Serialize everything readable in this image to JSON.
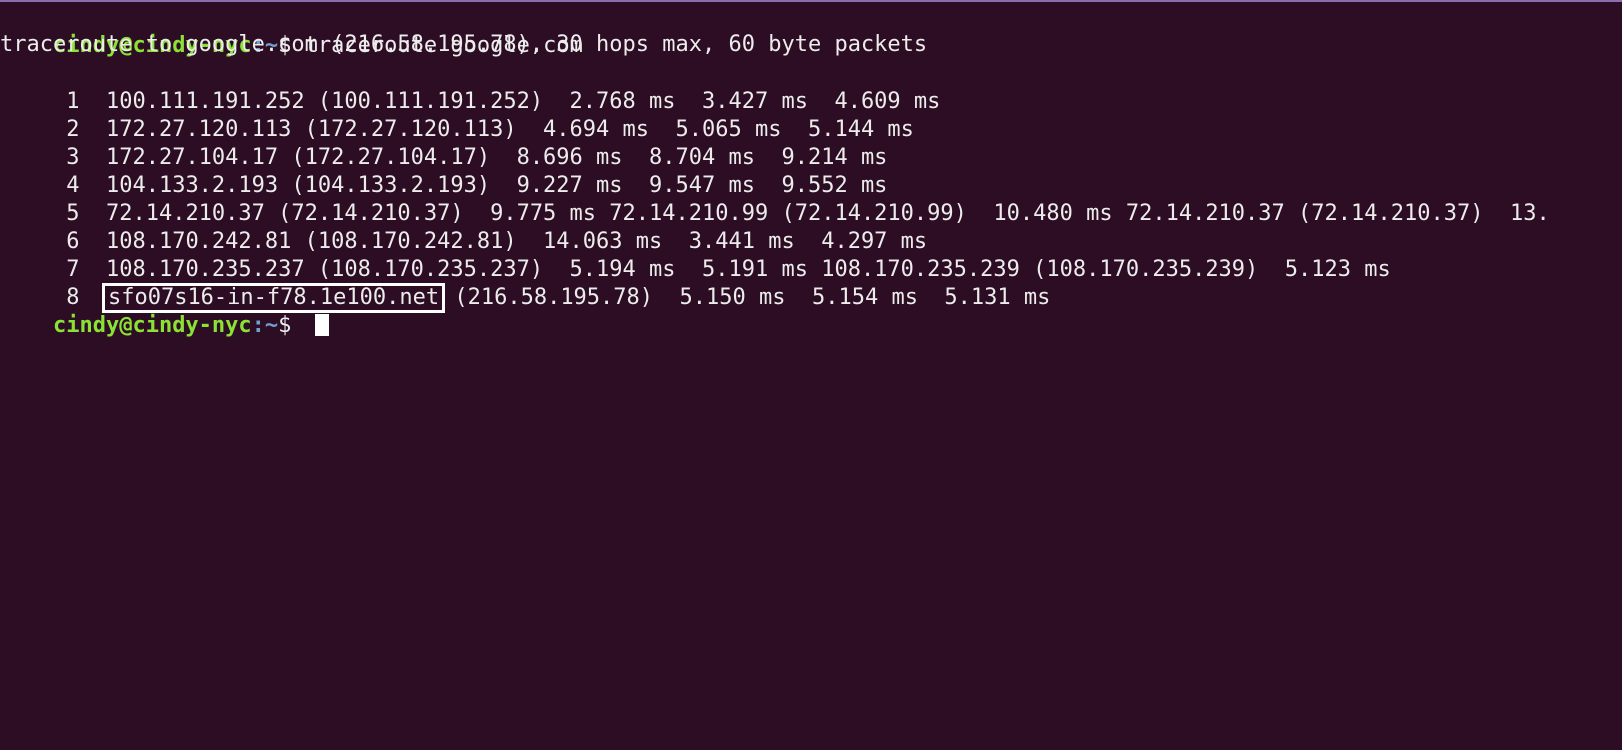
{
  "prompt": {
    "user_host": "cindy@cindy-nyc",
    "path": ":~",
    "symbol": "$ "
  },
  "command": "traceroute google.com",
  "header": "traceroute to google.com (216.58.195.78), 30 hops max, 60 byte packets",
  "hops": [
    {
      "num": " 1  ",
      "text": "100.111.191.252 (100.111.191.252)  2.768 ms  3.427 ms  4.609 ms"
    },
    {
      "num": " 2  ",
      "text": "172.27.120.113 (172.27.120.113)  4.694 ms  5.065 ms  5.144 ms"
    },
    {
      "num": " 3  ",
      "text": "172.27.104.17 (172.27.104.17)  8.696 ms  8.704 ms  9.214 ms"
    },
    {
      "num": " 4  ",
      "text": "104.133.2.193 (104.133.2.193)  9.227 ms  9.547 ms  9.552 ms"
    },
    {
      "num": " 5  ",
      "text": "72.14.210.37 (72.14.210.37)  9.775 ms 72.14.210.99 (72.14.210.99)  10.480 ms 72.14.210.37 (72.14.210.37)  13."
    },
    {
      "num": " 6  ",
      "text": "108.170.242.81 (108.170.242.81)  14.063 ms  3.441 ms  4.297 ms"
    },
    {
      "num": " 7  ",
      "text": "108.170.235.237 (108.170.235.237)  5.194 ms  5.191 ms 108.170.235.239 (108.170.235.239)  5.123 ms"
    },
    {
      "num": " 8  ",
      "host": "sfo07s16-in-f78.1e100.net",
      "text": " (216.58.195.78)  5.150 ms  5.154 ms  5.131 ms"
    }
  ],
  "colors": {
    "background": "#2c0d23",
    "prompt_user": "#8ae234",
    "prompt_path": "#729fcf",
    "text": "#ececec",
    "highlight_box": "#ffffff"
  }
}
